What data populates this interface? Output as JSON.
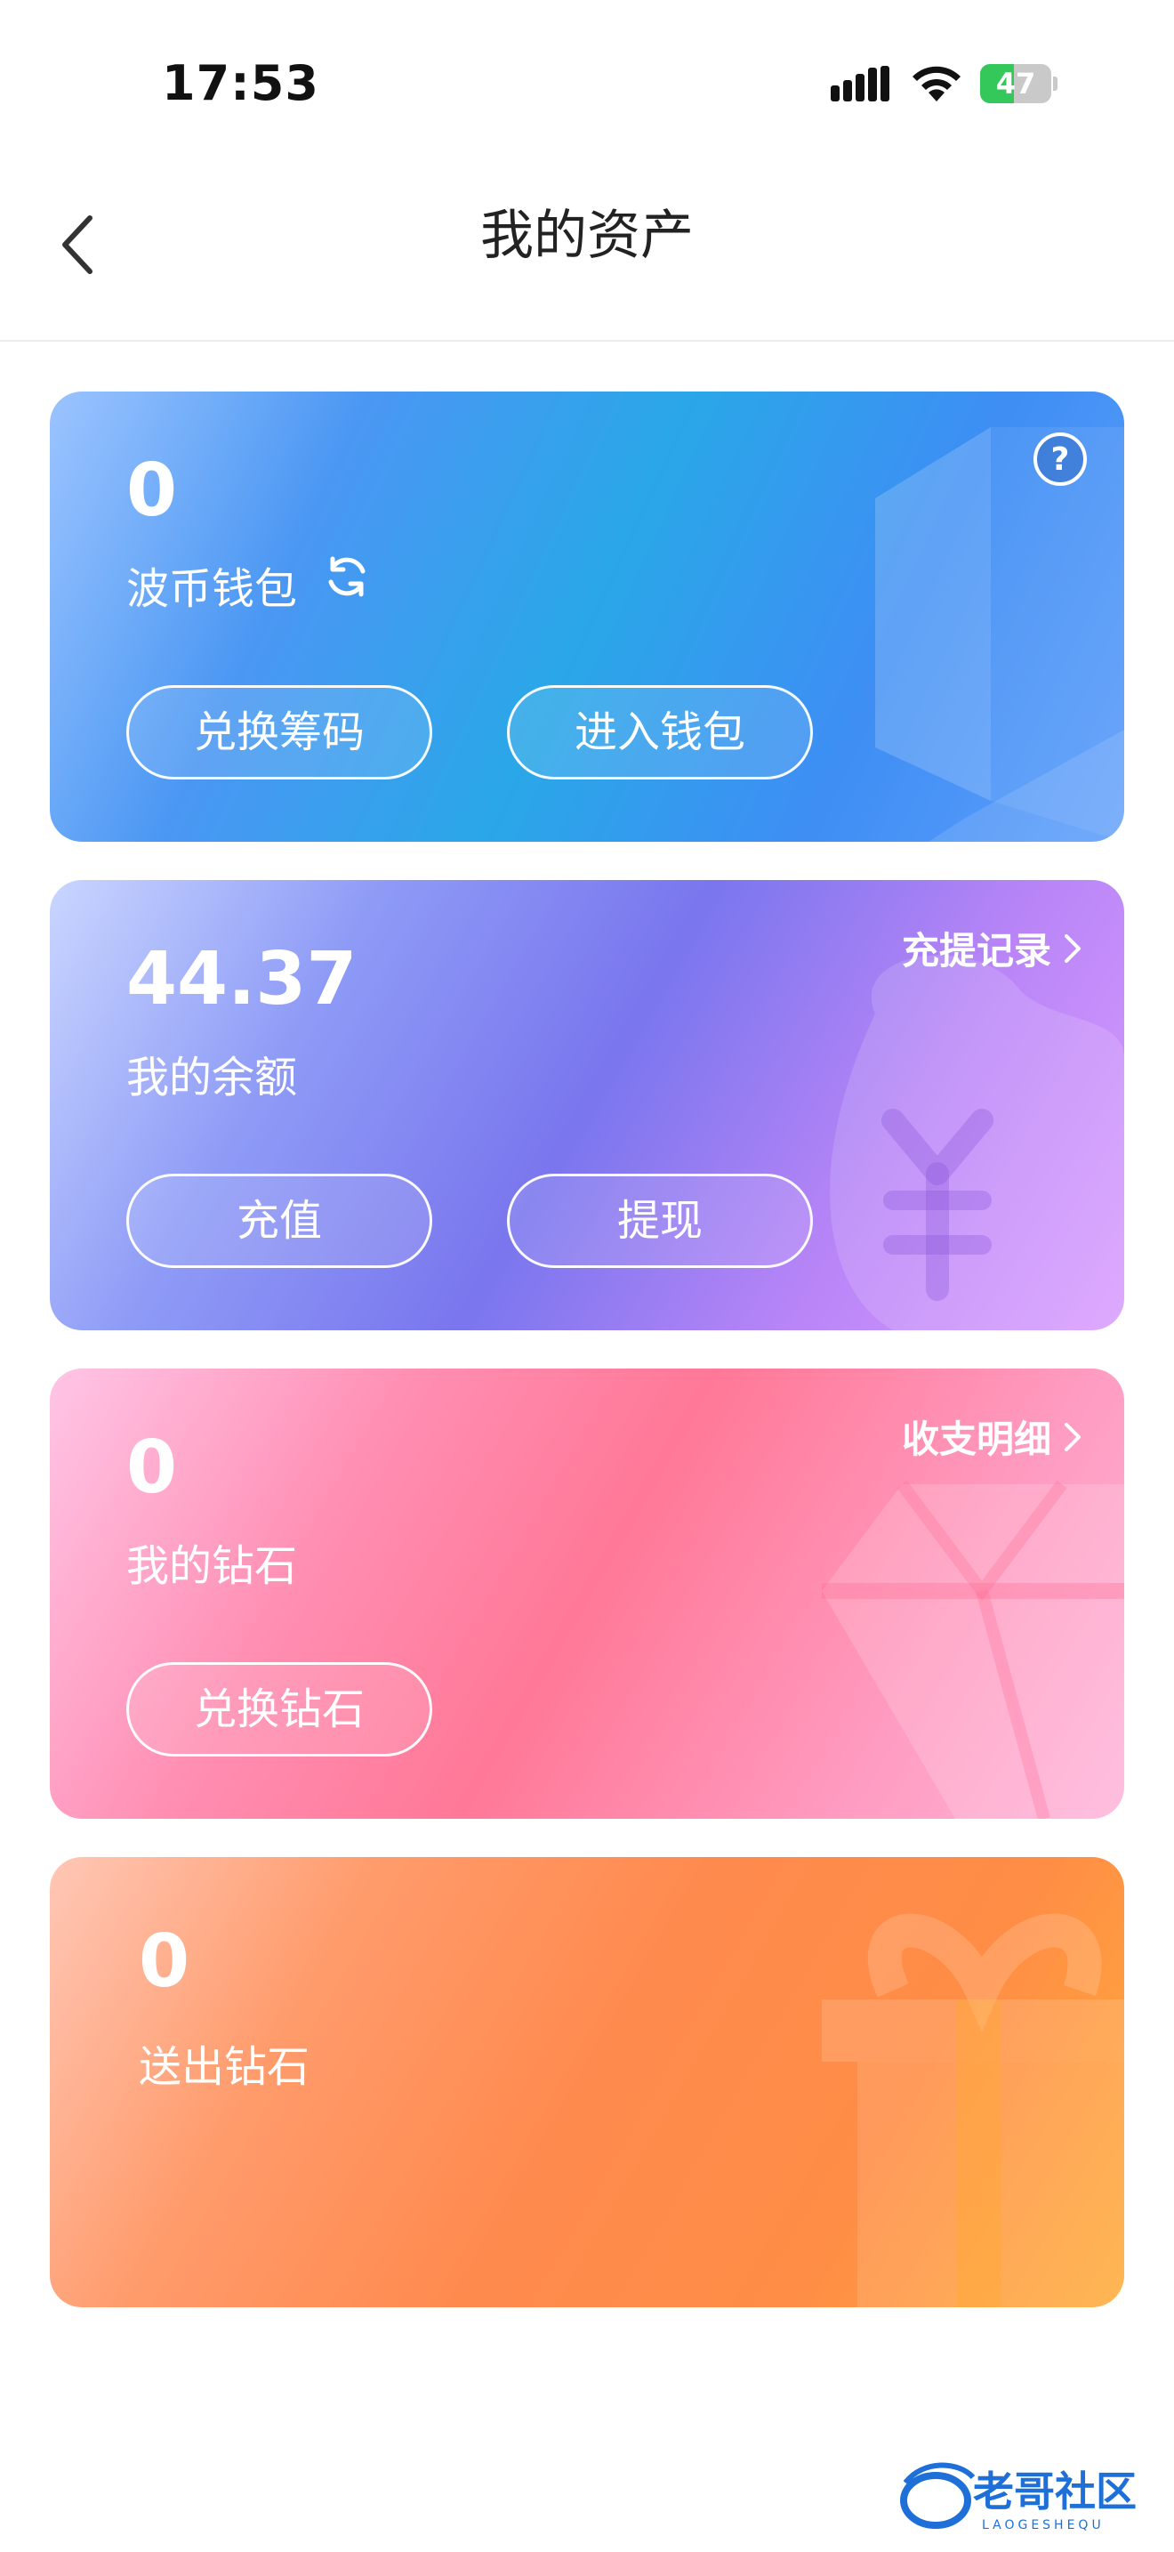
{
  "status_bar": {
    "time": "17:53",
    "battery_level": "47",
    "battery_fraction": 0.47
  },
  "nav": {
    "title": "我的资产",
    "back_icon": "chevron-left-icon"
  },
  "cards": [
    {
      "id": "bobi-wallet",
      "amount": "0",
      "label": "波币钱包",
      "buttons": [
        "兑换筹码",
        "进入钱包"
      ],
      "icons": [
        "refresh-icon",
        "help-icon"
      ]
    },
    {
      "id": "balance",
      "amount": "44.37",
      "label": "我的余额",
      "link": "充提记录",
      "buttons": [
        "充值",
        "提现"
      ]
    },
    {
      "id": "diamond",
      "amount": "0",
      "label": "我的钻石",
      "link": "收支明细",
      "buttons": [
        "兑换钻石"
      ]
    },
    {
      "id": "sent-diamond",
      "amount": "0",
      "label": "送出钻石"
    }
  ],
  "watermark": {
    "title": "老哥社区",
    "subtitle": "LAOGESHEQU"
  },
  "colors": {
    "card1": "#3e8ef4",
    "card2": "#7a76ee",
    "card3": "#ff7897",
    "card4": "#ff8a4e"
  }
}
